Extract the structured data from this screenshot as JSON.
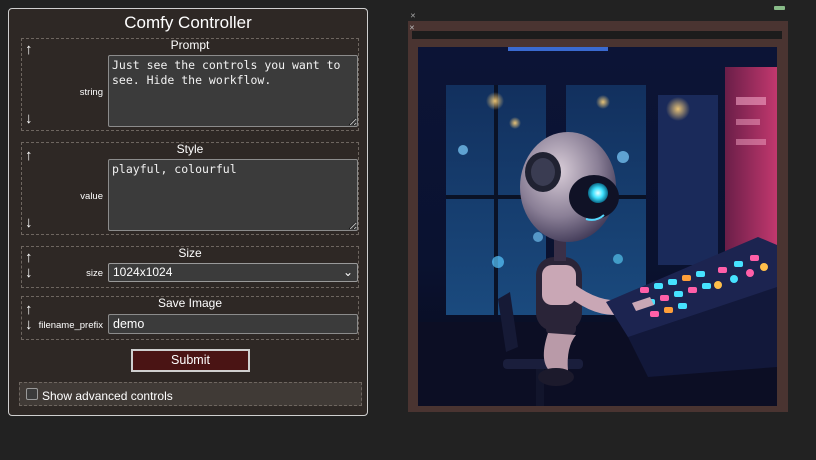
{
  "controller": {
    "title": "Comfy Controller",
    "groups": {
      "prompt": {
        "title": "Prompt",
        "field_label": "string",
        "value": "Just see the controls you want to see. Hide the workflow."
      },
      "style": {
        "title": "Style",
        "field_label": "value",
        "value": "playful, colourful"
      },
      "size": {
        "title": "Size",
        "field_label": "size",
        "value": "1024x1024"
      },
      "save_image": {
        "title": "Save Image",
        "field_label": "filename_prefix",
        "value": "demo"
      }
    },
    "submit_label": "Submit",
    "advanced_label": "Show advanced controls",
    "advanced_checked": false
  },
  "icons": {
    "move_up": "arrow-up",
    "move_down": "arrow-down",
    "dropdown": "chevron-down",
    "close": "close-x"
  },
  "viewer": {
    "image_subject": "robot at a synthesizer keyboard"
  },
  "colors": {
    "panel_bg": "#2e2825",
    "submit_bg": "#4a1414",
    "viewer_frame": "#4a3431"
  }
}
